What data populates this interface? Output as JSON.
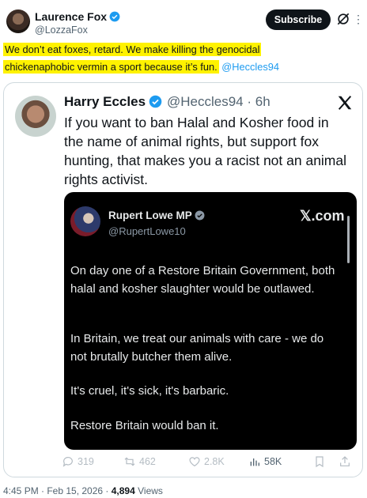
{
  "author": {
    "name": "Laurence Fox",
    "handle": "@LozzaFox"
  },
  "subscribe_label": "Subscribe",
  "tweet": {
    "line1": "We don’t eat foxes, retard. We make killing the genocidal",
    "line2": "chickenaphobic vermin a sport because it’s fun.",
    "mention": "@Heccles94"
  },
  "quote": {
    "name": "Harry Eccles",
    "handle_time": "@Heccles94 · 6h",
    "text": "If you want to ban Halal and Kosher food in the name of animal rights, but support fox hunting, that makes you a racist not an animal rights activist."
  },
  "image": {
    "name": "Rupert Lowe MP",
    "handle": "@RupertLowe10",
    "brand": "𝕏.com",
    "p1": "On day one of a Restore Britain Government, both halal and kosher slaughter would be outlawed.",
    "p2": "In Britain, we treat our animals with care - we do not brutally butcher them alive.",
    "p3": "It's cruel, it's sick, it's barbaric.",
    "p4": "Restore Britain would ban it."
  },
  "actions": {
    "replies": "319",
    "reposts": "462",
    "likes": "2.8K",
    "views": "58K"
  },
  "meta": {
    "time_date": "4:45 PM · Feb 15, 2026 · ",
    "views_count": "4,894",
    "views_label": " Views"
  },
  "colors": {
    "accent": "#1d9bf0",
    "highlight": "#fff200",
    "text": "#0f1419",
    "muted": "#536471"
  }
}
